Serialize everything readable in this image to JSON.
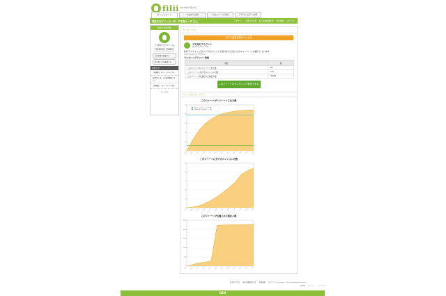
{
  "header": {
    "logo_text": "filii",
    "date_text": "2014年05月06日",
    "nav_tabs": [
      "ダッシュボード",
      "つながり分析",
      "プロフィール分析",
      "アクティビティ分析"
    ]
  },
  "greenbar": {
    "user_text": "現在のログインユーザ：デモ用ユーザ さん",
    "links": [
      "アカウント",
      "お問い合わせ",
      "個人情報保護方針",
      "利用規約",
      "ログアウト"
    ]
  },
  "sidebar": {
    "heading": "現在の分析対象",
    "account_name": "デモ用のアカウント さん",
    "social": [
      "facebook",
      "twitter"
    ],
    "buttons": [
      "分析対象を変更する",
      "取り扱い方を確認する"
    ],
    "news_heading": "お知らせ",
    "news": [
      "【新機能】 ダッシュボードから...",
      "NAVER にタイルを提供開始しました",
      "【新機能】 アクティビティ分析..."
    ],
    "more": "もっと見る"
  },
  "main": {
    "section_title": "モニタープラン",
    "status_banner": "大きな反響を集めています",
    "account": {
      "name": "デモ用のアカウント",
      "screen_name": "@demo_yusui_data"
    },
    "tweet": "新作デスクトップのカメラをクリックで見れます大当たりのキャンペーンを紹介しています",
    "tweet_date": "2014年04月17日 13時51分",
    "summary_title": "モニタリングサマリー情報",
    "table_headers": [
      "項目",
      "値"
    ],
    "table_rows": [
      [
        "このツイートがリツイートされた数",
        "80"
      ],
      [
        "このツイートに対するメンションの数",
        "107"
      ],
      [
        "このツイートが伝播された推定人数",
        "40682"
      ]
    ],
    "stop_button": "このツイートのモニタリングを終了する",
    "graph_section_title": "ツイートモニターグラフ"
  },
  "charts_block": {
    "legend_a": "このツイートがリツイートされた数",
    "legend_b": "2014年04月17日の公開ツイート数"
  },
  "chart_data": [
    {
      "type": "area",
      "title": "このツイートがリツイートされた数",
      "x": [
        "13:51",
        "14:52",
        "15:53",
        "16:54",
        "17:55",
        "18:56",
        "19:57",
        "20:58",
        "21:59",
        "23:00",
        "00:01",
        "01:02"
      ],
      "series": [
        {
          "name": "このツイートがリツイートされた数",
          "values": [
            0,
            22,
            40,
            53,
            62,
            69,
            73,
            76,
            78,
            79,
            80,
            80
          ]
        }
      ],
      "reference_lines": [
        70,
        10
      ],
      "ylim": [
        0,
        90
      ],
      "colors": {
        "fill": "#f9d07f",
        "line": "#e9b43f",
        "ref1": "#48b8c9",
        "ref2": "#6cab3a"
      }
    },
    {
      "type": "area",
      "title": "このツイートに対するメンションの数",
      "x": [
        "13:51",
        "14:52",
        "15:53",
        "16:54",
        "17:55",
        "18:56",
        "19:57",
        "20:58",
        "21:59",
        "23:00",
        "00:01",
        "01:02"
      ],
      "series": [
        {
          "name": "このツイートに対するメンションの数",
          "values": [
            0,
            2,
            5,
            12,
            20,
            30,
            42,
            55,
            70,
            90,
            100,
            107
          ]
        }
      ],
      "ylim": [
        0,
        120
      ],
      "colors": {
        "fill": "#f9d07f",
        "line": "#e9b43f"
      }
    },
    {
      "type": "area",
      "title": "このツイートが伝播された推定人数",
      "x": [
        "13:51",
        "14:52",
        "15:53",
        "16:54",
        "17:55",
        "18:56",
        "19:57",
        "20:58",
        "21:59",
        "23:00",
        "00:01",
        "01:02"
      ],
      "series": [
        {
          "name": "このツイートが伝播された推定人数",
          "values": [
            0,
            1500,
            3000,
            4000,
            5000,
            40000,
            40400,
            40500,
            40600,
            40650,
            40680,
            40682
          ]
        }
      ],
      "ylim": [
        0,
        45000
      ],
      "colors": {
        "fill": "#f9d07f",
        "line": "#e9b43f"
      }
    }
  ],
  "footer": {
    "links": [
      "お問い合わせ",
      "個人情報保護方針",
      "利用規約",
      "ログアウト"
    ],
    "copyright": "Copyright © Filii Ltd. All Rights Reserved.",
    "links2": [
      "会社概要",
      "プライバシー",
      "サイトマップ"
    ],
    "bar_text": "filii"
  }
}
